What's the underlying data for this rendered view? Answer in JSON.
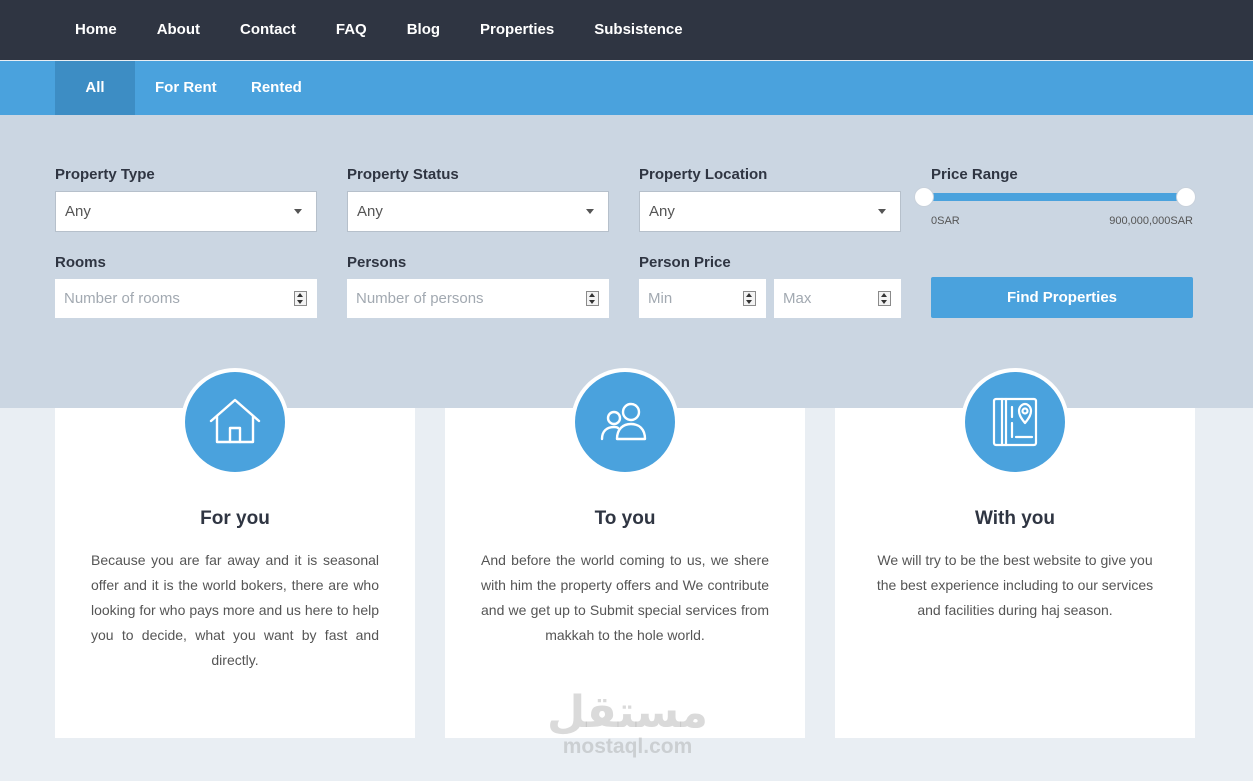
{
  "nav": {
    "items": [
      "Home",
      "About",
      "Contact",
      "FAQ",
      "Blog",
      "Properties",
      "Subsistence"
    ]
  },
  "tabs": [
    "All",
    "For Rent",
    "Rented"
  ],
  "search": {
    "property_type": {
      "label": "Property Type",
      "value": "Any"
    },
    "property_status": {
      "label": "Property Status",
      "value": "Any"
    },
    "property_location": {
      "label": "Property Location",
      "value": "Any"
    },
    "price_range": {
      "label": "Price Range",
      "min_label": "0SAR",
      "max_label": "900,000,000SAR",
      "low_fraction": 0,
      "high_fraction": 1
    },
    "rooms": {
      "label": "Rooms",
      "placeholder": "Number of rooms"
    },
    "persons": {
      "label": "Persons",
      "placeholder": "Number of persons"
    },
    "person_price": {
      "label": "Person Price",
      "min_placeholder": "Min",
      "max_placeholder": "Max"
    },
    "find_button": "Find Properties"
  },
  "cards": [
    {
      "icon": "house-icon",
      "title": "For you",
      "text": "Because you are far away and it is seasonal offer and it is the world bokers, there are who looking for who pays more and us here to help you to decide, what you want by fast and directly."
    },
    {
      "icon": "people-icon",
      "title": "To you",
      "text": "And before the world coming to us, we shere with him the property offers and We contribute and we get up to Submit special services from makkah to the hole world."
    },
    {
      "icon": "map-book-icon",
      "title": "With you",
      "text": "We will try to be the best website to give you the best experience including to our services and facilities during haj season."
    }
  ],
  "watermark": {
    "arabic": "مستقل",
    "latin": "mostaql.com"
  },
  "colors": {
    "nav_bg": "#2f3542",
    "accent": "#4aa2dd",
    "panel_bg": "#cbd6e2",
    "page_bg": "#e9eef3"
  }
}
